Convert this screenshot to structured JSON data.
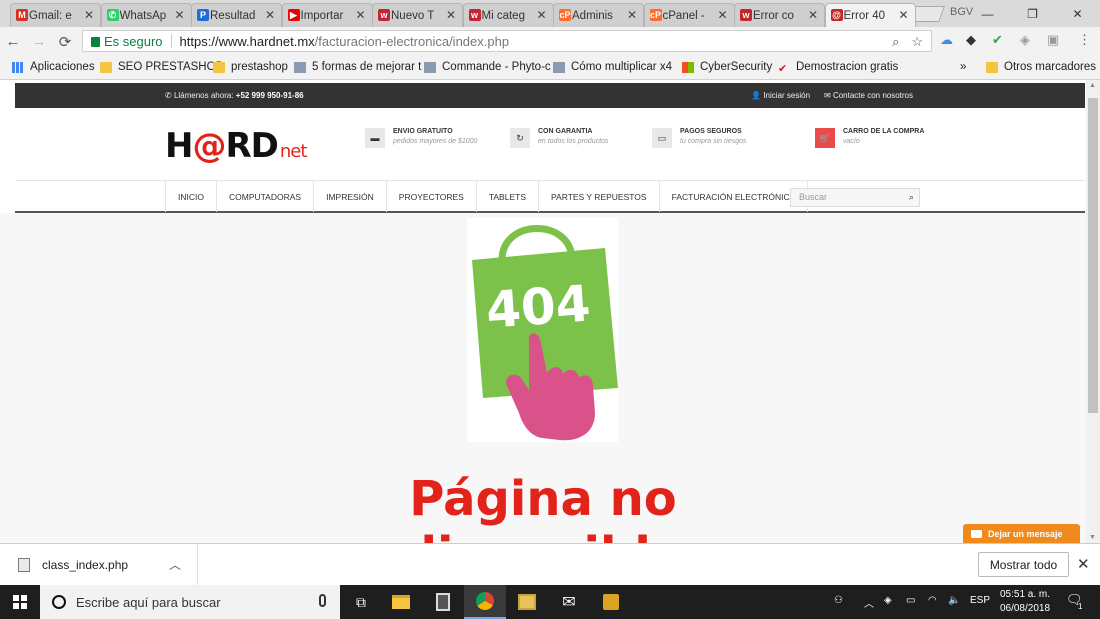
{
  "browser": {
    "tabs": [
      {
        "label": "Gmail: e",
        "icon": "gmail-icon",
        "color": "#d93025",
        "glyph": "M"
      },
      {
        "label": "WhatsAp",
        "icon": "whatsapp-icon",
        "color": "#25d366",
        "glyph": "✆"
      },
      {
        "label": "Resultad",
        "icon": "ticket-icon",
        "color": "#1d6fd6",
        "glyph": "P"
      },
      {
        "label": "Importar",
        "icon": "youtube-icon",
        "color": "#e00",
        "glyph": "▶"
      },
      {
        "label": "Nuevo T",
        "icon": "wix-icon",
        "color": "#c4262e",
        "glyph": "w"
      },
      {
        "label": "Mi categ",
        "icon": "wix-icon",
        "color": "#c4262e",
        "glyph": "w"
      },
      {
        "label": "Adminis",
        "icon": "cpanel-icon",
        "color": "#ff6c2c",
        "glyph": "cP"
      },
      {
        "label": "cPanel -",
        "icon": "cpanel-icon",
        "color": "#ff6c2c",
        "glyph": "cP"
      },
      {
        "label": "Error co",
        "icon": "wix-icon",
        "color": "#c4262e",
        "glyph": "w"
      },
      {
        "label": "Error 40",
        "icon": "hardnet-icon",
        "color": "#c4262e",
        "glyph": "@"
      }
    ],
    "profile_label": "BGV",
    "secure_label": "Es seguro",
    "url_host": "https://www.hardnet.mx",
    "url_path": "/facturacion-electronica/index.php"
  },
  "bookmarks": {
    "apps_label": "Aplicaciones",
    "items": [
      {
        "label": "SEO PRESTASHOP",
        "icon": "folder-icon"
      },
      {
        "label": "prestashop",
        "icon": "folder-icon"
      },
      {
        "label": "5 formas de mejorar t",
        "icon": "page-icon"
      },
      {
        "label": "Commande - Phyto-c",
        "icon": "page-icon"
      },
      {
        "label": "Cómo multiplicar x4",
        "icon": "page-icon"
      },
      {
        "label": "CyberSecurity",
        "icon": "microsoft-icon"
      },
      {
        "label": "Demostracion gratis",
        "icon": "checkmark-icon"
      }
    ],
    "overflow_label": "»",
    "other_label": "Otros marcadores"
  },
  "site": {
    "topbar": {
      "call_prefix": "Llámenos ahora: ",
      "phone": "+52 999 950-91-86",
      "login": "Iniciar sesión",
      "contact": "Contacte con nosotros"
    },
    "logo": {
      "part1": "H",
      "at": "@",
      "part2": "RD",
      "net": "net"
    },
    "features": [
      {
        "title": "ENVIO GRATUITO",
        "subtitle": "pedidos mayores de $1000",
        "icon": "truck-icon"
      },
      {
        "title": "CON GARANTIA",
        "subtitle": "en todos los productos",
        "icon": "refresh-icon"
      },
      {
        "title": "PAGOS SEGUROS",
        "subtitle": "tu compra sin riesgos",
        "icon": "credit-card-icon"
      },
      {
        "title": "CARRO DE LA COMPRA",
        "subtitle": "vacío",
        "icon": "cart-icon"
      }
    ],
    "menu": [
      "INICIO",
      "COMPUTADORAS",
      "IMPRESIÓN",
      "PROYECTORES",
      "TABLETS",
      "PARTES Y REPUESTOS",
      "FACTURACIÓN ELECTRÓNICA"
    ],
    "search_placeholder": "Buscar",
    "error_code": "404",
    "error_message_line1": "Página no",
    "error_message_line2": "disponible",
    "chat_label": "Dejar un mensaje",
    "colors": {
      "brand_red": "#e2231a",
      "bag_green": "#7cc24a",
      "hand_pink": "#d9538a",
      "chat_orange": "#f08a1c"
    }
  },
  "downloads": {
    "filename": "class_index.php",
    "show_all": "Mostrar todo"
  },
  "taskbar": {
    "search_placeholder": "Escribe aquí para buscar",
    "language": "ESP",
    "time": "05:51 a. m.",
    "date": "06/08/2018",
    "notifications": "1"
  }
}
